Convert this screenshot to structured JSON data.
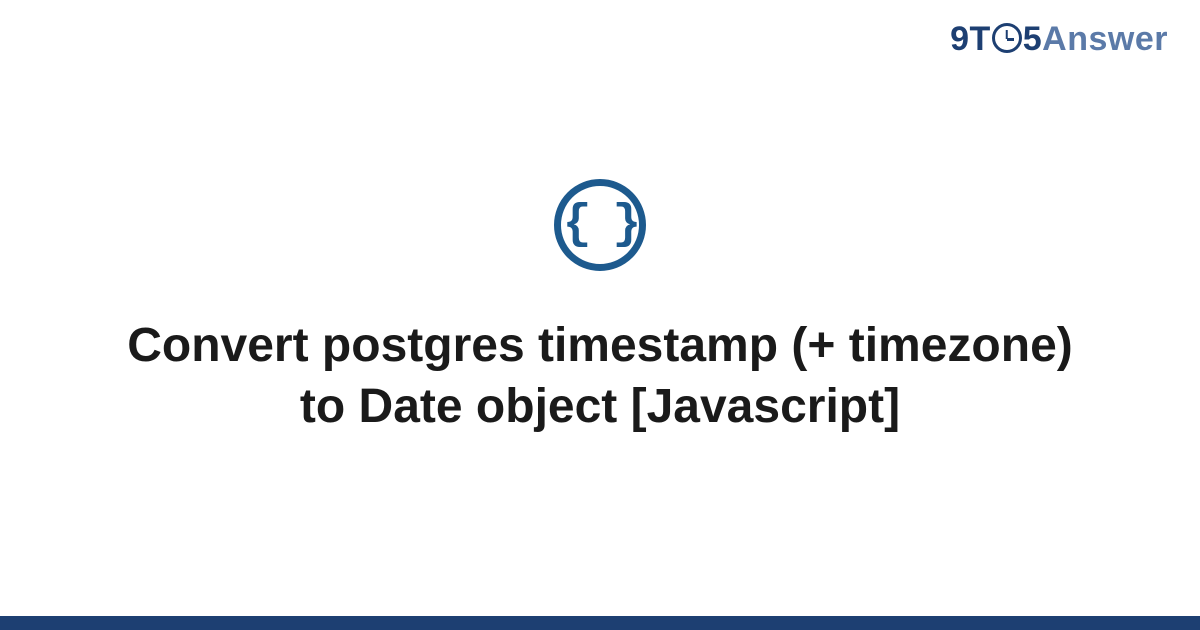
{
  "brand": {
    "part1": "9T",
    "part2": "5",
    "part3": "Answer"
  },
  "icon": {
    "glyph": "{ }",
    "name": "code-braces-icon"
  },
  "title": "Convert postgres timestamp (+ timezone) to Date object [Javascript]",
  "colors": {
    "accent_dark": "#1d3f72",
    "accent_mid": "#1d5a8e",
    "accent_light": "#5b7aa8"
  }
}
